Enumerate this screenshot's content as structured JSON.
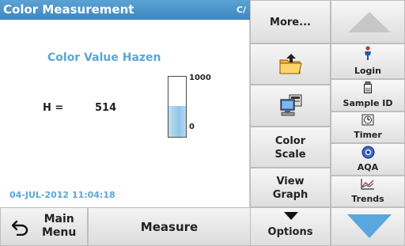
{
  "header": {
    "title": "Color Measurement",
    "corner": "C/"
  },
  "measurement": {
    "title": "Color Value Hazen",
    "label": "H =",
    "value": "514",
    "scale": {
      "max_label": "1000",
      "min_label": "0",
      "level_fraction": 0.514
    }
  },
  "timestamp": "04-JUL-2012 11:04:18",
  "bottom_bar": {
    "main_menu_label": "Main\nMenu",
    "measure_label": "Measure"
  },
  "middle_column": {
    "more_label": "More...",
    "color_scale_label": "Color\nScale",
    "view_graph_label": "View\nGraph",
    "options_label": "Options"
  },
  "side_column": {
    "login_label": "Login",
    "sample_id_label": "Sample ID",
    "timer_label": "Timer",
    "aqa_label": "AQA",
    "trends_label": "Trends"
  },
  "colors": {
    "header_blue": "#4a94c9",
    "accent_text": "#5aa6d6",
    "nav_down_arrow": "#5aa6df",
    "scale_fill": "#8fc4e8"
  },
  "icons": {
    "back": "back-arrow-icon",
    "export": "folder-export-icon",
    "pc": "computer-icon",
    "login": "person-icon",
    "sample_id": "sample-bottle-icon",
    "timer": "timer-icon",
    "aqa": "aqa-icon",
    "trends": "trend-chart-icon"
  }
}
